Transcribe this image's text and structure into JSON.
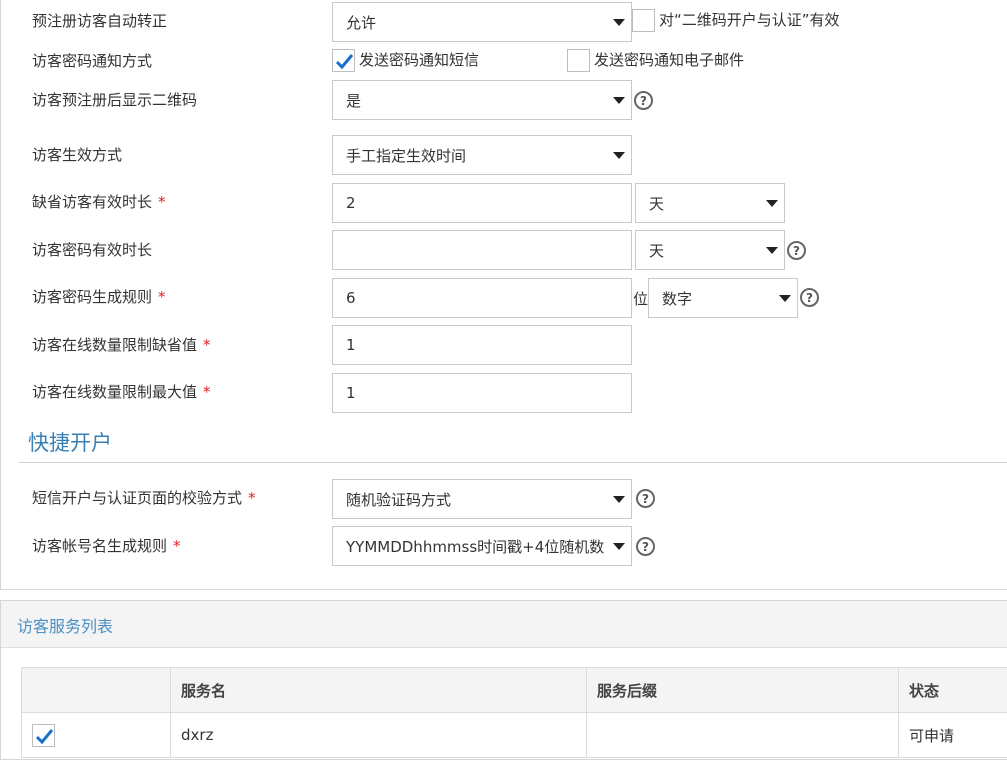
{
  "settings": {
    "auto_convert": {
      "label": "预注册访客自动转正",
      "value": "允许",
      "option_label": "对“二维码开户与认证”有效",
      "option_checked": false
    },
    "pwd_notify": {
      "label": "访客密码通知方式",
      "sms_label": "发送密码通知短信",
      "sms_checked": true,
      "email_label": "发送密码通知电子邮件",
      "email_checked": false
    },
    "show_qr": {
      "label": "访客预注册后显示二维码",
      "value": "是"
    },
    "effective_mode": {
      "label": "访客生效方式",
      "value": "手工指定生效时间"
    },
    "default_duration": {
      "label": "缺省访客有效时长",
      "required": "*",
      "value": "2",
      "unit": "天"
    },
    "pwd_duration": {
      "label": "访客密码有效时长",
      "value": "",
      "unit": "天"
    },
    "pwd_rule": {
      "label": "访客密码生成规则",
      "required": "*",
      "value": "6",
      "unit_text": "位",
      "type": "数字"
    },
    "online_default": {
      "label": "访客在线数量限制缺省值",
      "required": "*",
      "value": "1"
    },
    "online_max": {
      "label": "访客在线数量限制最大值",
      "required": "*",
      "value": "1"
    }
  },
  "quick": {
    "title": "快捷开户",
    "verify_method": {
      "label": "短信开户与认证页面的校验方式",
      "required": "*",
      "value": "随机验证码方式"
    },
    "account_rule": {
      "label": "访客帐号名生成规则",
      "required": "*",
      "value": "YYMMDDhhmmss时间戳+4位随机数"
    }
  },
  "services": {
    "title": "访客服务列表",
    "columns": [
      "",
      "服务名",
      "服务后缀",
      "状态"
    ],
    "rows": [
      {
        "checked": true,
        "name": "dxrz",
        "suffix": "",
        "status": "可申请"
      }
    ]
  },
  "icons": {
    "help": "?"
  },
  "colors": {
    "accent": "#3a7fb4",
    "required": "#e02020",
    "check": "#1a6fc9"
  }
}
